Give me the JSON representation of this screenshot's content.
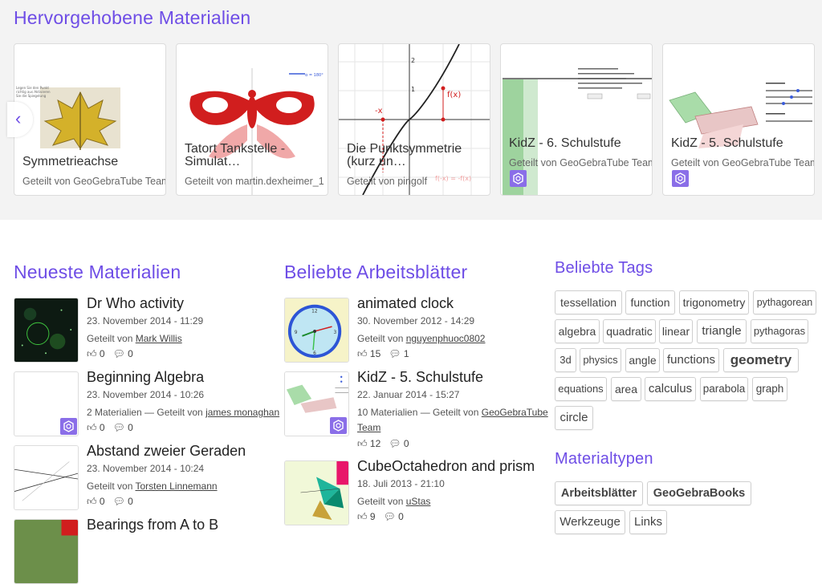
{
  "featured": {
    "title": "Hervorgehobene Materialien",
    "cards": [
      {
        "title": "Symmetrieachse",
        "shared": "Geteilt von GeoGebraTube Team"
      },
      {
        "title": "Tatort Tankstelle - Simulat…",
        "shared": "Geteilt von martin.dexheimer_1"
      },
      {
        "title": "Die Punktsymmetrie (kurz un…",
        "shared": "Geteilt von pingolf"
      },
      {
        "title": "KidZ - 6. Schulstufe",
        "shared": "Geteilt von GeoGebraTube Team"
      },
      {
        "title": "KidZ - 5. Schulstufe",
        "shared": "Geteilt von GeoGebraTube Team"
      }
    ],
    "prev_icon": "‹"
  },
  "newest": {
    "title": "Neueste Materialien",
    "items": [
      {
        "title": "Dr Who activity",
        "date": "23. November 2014 - 11:29",
        "shared_prefix": "Geteilt von ",
        "user": "Mark Willis",
        "likes": "0",
        "comments": "0"
      },
      {
        "title": "Beginning Algebra",
        "date": "23. November 2014 - 10:26",
        "shared_prefix": "2 Materialien — Geteilt von ",
        "user": "james monaghan",
        "likes": "0",
        "comments": "0"
      },
      {
        "title": "Abstand zweier Geraden",
        "date": "23. November 2014 - 10:24",
        "shared_prefix": "Geteilt von ",
        "user": "Torsten Linnemann",
        "likes": "0",
        "comments": "0"
      },
      {
        "title": "Bearings from A to B"
      }
    ]
  },
  "popular": {
    "title": "Beliebte Arbeitsblätter",
    "items": [
      {
        "title": "animated clock",
        "date": "30. November 2012 - 14:29",
        "shared_prefix": "Geteilt von ",
        "user": "nguyenphuoc0802",
        "likes": "15",
        "comments": "1"
      },
      {
        "title": "KidZ - 5. Schulstufe",
        "date": "22. Januar 2014 - 15:27",
        "shared_prefix": "10 Materialien — Geteilt von ",
        "user": "GeoGebraTube",
        "user2": "Team",
        "likes": "12",
        "comments": "0"
      },
      {
        "title": "CubeOctahedron and prism",
        "date": "18. Juli 2013 - 21:10",
        "shared_prefix": "Geteilt von ",
        "user": "uStas",
        "likes": "9",
        "comments": "0"
      }
    ]
  },
  "tags": {
    "title": "Beliebte Tags",
    "items": [
      "tessellation",
      "function",
      "trigonometry",
      "pythagorean",
      "algebra",
      "quadratic",
      "linear",
      "triangle",
      "pythagoras",
      "3d",
      "physics",
      "angle",
      "functions",
      "geometry",
      "equations",
      "area",
      "calculus",
      "parabola",
      "graph",
      "circle"
    ]
  },
  "types": {
    "title": "Materialtypen",
    "items": [
      "Arbeitsblätter",
      "GeoGebraBooks",
      "Werkzeuge",
      "Links"
    ]
  },
  "colors": {
    "accent": "#6e4de6",
    "badge": "#8a6ee8",
    "bg_featured": "#f3f3f3"
  },
  "icons": {
    "like": "thumbs-up-icon",
    "comment": "comment-icon",
    "book": "geogebrabook-icon",
    "prev": "chevron-left-icon"
  }
}
